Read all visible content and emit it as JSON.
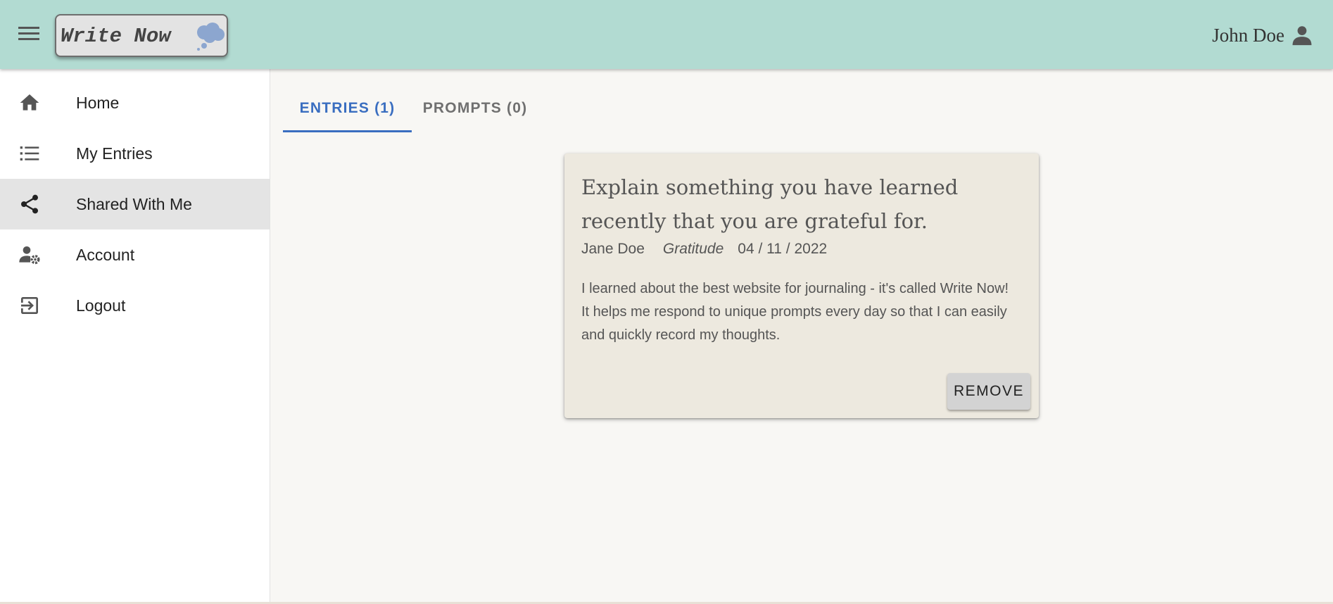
{
  "header": {
    "app_name": "Write Now",
    "user_name": "John Doe"
  },
  "sidebar": {
    "items": [
      {
        "label": "Home",
        "icon": "home-icon"
      },
      {
        "label": "My Entries",
        "icon": "list-icon"
      },
      {
        "label": "Shared With Me",
        "icon": "share-icon",
        "active": true
      },
      {
        "label": "Account",
        "icon": "account-settings-icon"
      },
      {
        "label": "Logout",
        "icon": "logout-icon"
      }
    ]
  },
  "tabs": [
    {
      "label": "ENTRIES (1)",
      "active": true
    },
    {
      "label": "PROMPTS (0)",
      "active": false
    }
  ],
  "entry": {
    "title": "Explain something you have learned recently that you are grateful for.",
    "author": "Jane Doe",
    "category": "Gratitude",
    "date": "04 / 11 / 2022",
    "body": "I learned about the best website for journaling - it's called Write Now! It helps me respond to unique prompts every day so that I can easily and quickly record my thoughts.",
    "remove_label": "REMOVE"
  },
  "colors": {
    "header_bg": "#b2dbd2",
    "accent": "#3a6ec0",
    "card_bg": "#ede9df",
    "page_bg": "#f8f7f4"
  }
}
